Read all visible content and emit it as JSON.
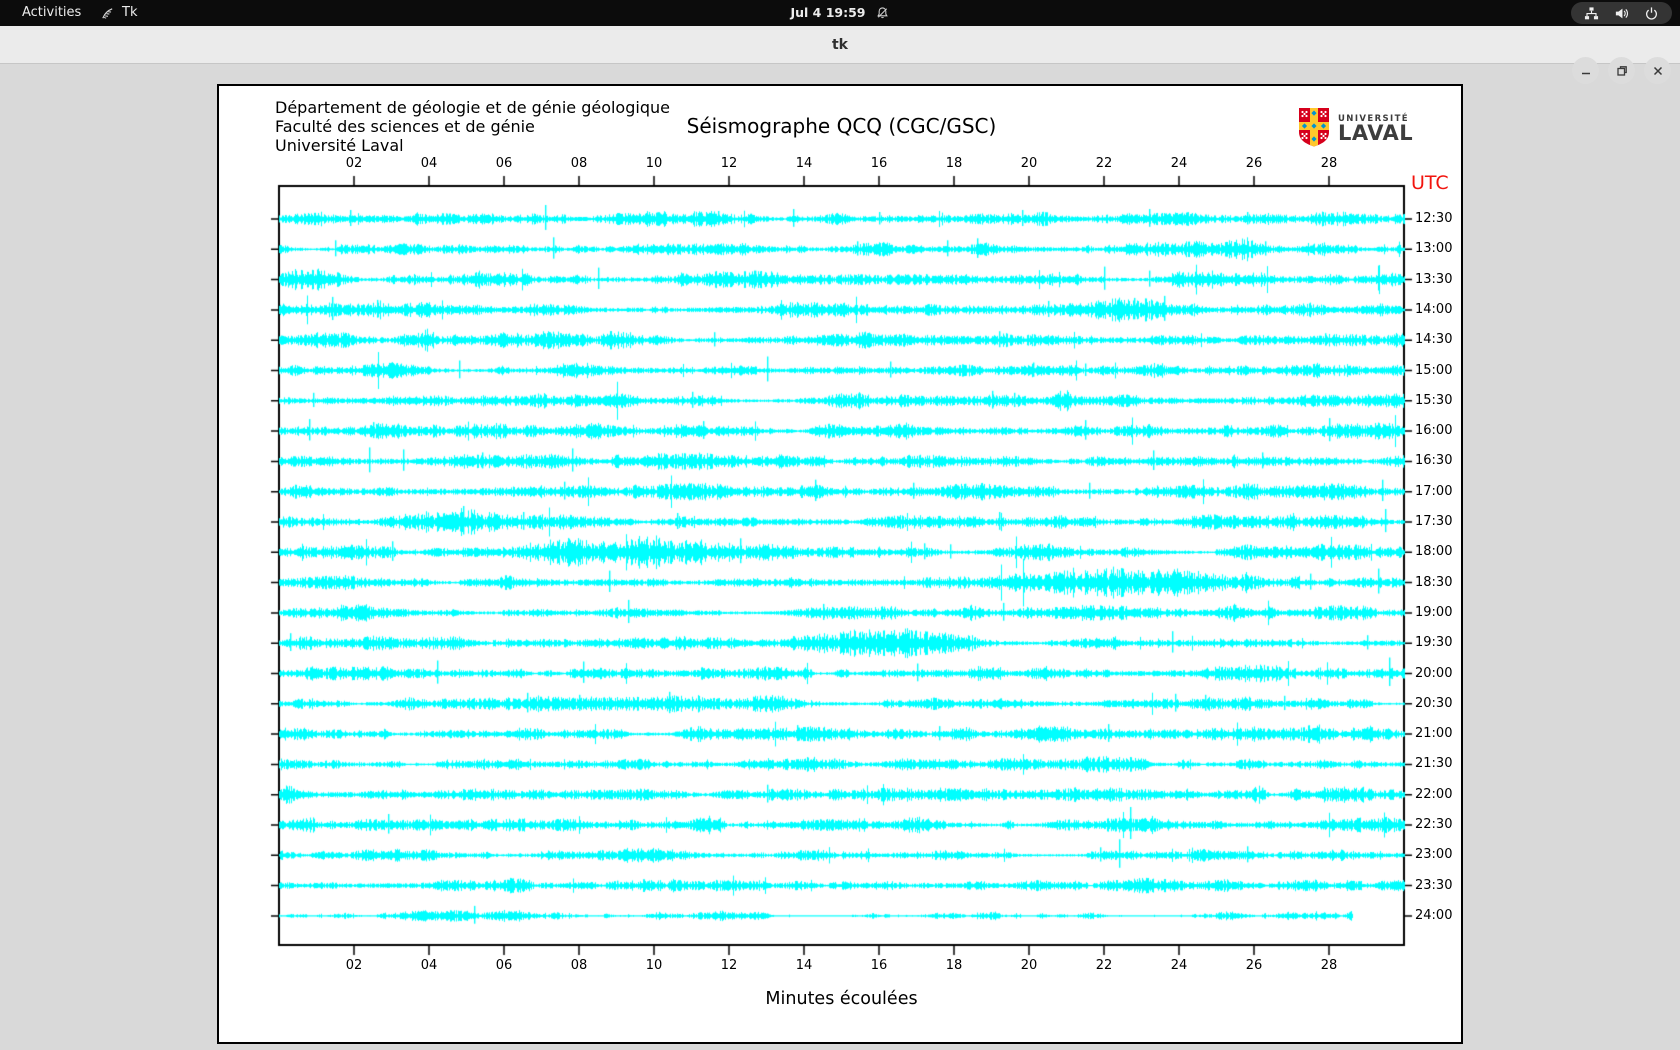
{
  "topbar": {
    "activities": "Activities",
    "app_menu": "Tk",
    "clock": "Jul 4 19:59"
  },
  "titlebar": {
    "title": "tk"
  },
  "panel": {
    "org_lines": [
      "Département de géologie et de génie géologique",
      "Faculté des sciences et de génie",
      "Université Laval"
    ],
    "title": "Séismographe QCQ (CGC/GSC)",
    "logo": {
      "top": "UNIVERSITÉ",
      "bottom": "LAVAL"
    },
    "utc": "UTC",
    "xlabel": "Minutes écoulées"
  },
  "chart_data": {
    "type": "line",
    "subtype": "helicorder",
    "title": "Séismographe QCQ (CGC/GSC)",
    "xlabel": "Minutes écoulées",
    "right_axis_label": "UTC",
    "x_range_minutes": [
      0,
      30
    ],
    "x_ticks": [
      "02",
      "04",
      "06",
      "08",
      "10",
      "12",
      "14",
      "16",
      "18",
      "20",
      "22",
      "24",
      "26",
      "28"
    ],
    "trace_color": "#00ffff",
    "axis_color": "#000000",
    "utc_color": "#f2140e",
    "rows": [
      {
        "label": "12:30",
        "base": 3.0,
        "end": 30,
        "bursts": [
          [
            0.2,
            1.6,
            2.0
          ]
        ],
        "spikes": [
          [
            1.9,
            9
          ],
          [
            7.1,
            14
          ],
          [
            11.7,
            8
          ],
          [
            13.7,
            10
          ],
          [
            16.0,
            7
          ],
          [
            19.8,
            9
          ],
          [
            23.2,
            10
          ],
          [
            25.8,
            7
          ]
        ]
      },
      {
        "label": "13:00",
        "base": 3.0,
        "end": 30,
        "bursts": [
          [
            25.0,
            26.5,
            2.5
          ]
        ],
        "spikes": [
          [
            1.5,
            9
          ],
          [
            7.3,
            12
          ],
          [
            15.4,
            8
          ],
          [
            17.8,
            9
          ],
          [
            18.6,
            11
          ],
          [
            26.3,
            8
          ]
        ]
      },
      {
        "label": "13:30",
        "base": 3.2,
        "end": 30,
        "bursts": [
          [
            0.0,
            1.8,
            2.5
          ]
        ],
        "spikes": [
          [
            8.5,
            12
          ],
          [
            12.7,
            9
          ],
          [
            22.0,
            13
          ],
          [
            23.2,
            9
          ],
          [
            29.3,
            14
          ]
        ]
      },
      {
        "label": "14:00",
        "base": 3.0,
        "end": 30,
        "bursts": [
          [
            2.2,
            3.2,
            3.5
          ],
          [
            21.5,
            24.3,
            3.5
          ]
        ],
        "spikes": [
          [
            1.4,
            13
          ],
          [
            2.6,
            10
          ],
          [
            20.5,
            9
          ],
          [
            22.8,
            12
          ],
          [
            23.6,
            14
          ]
        ]
      },
      {
        "label": "14:30",
        "base": 2.9,
        "end": 30,
        "bursts": [
          [
            3.6,
            4.4,
            3.0
          ],
          [
            8.4,
            9.8,
            3.5
          ]
        ],
        "spikes": [
          [
            11.6,
            8
          ],
          [
            19.2,
            9
          ],
          [
            27.9,
            7
          ]
        ]
      },
      {
        "label": "15:00",
        "base": 2.9,
        "end": 30,
        "bursts": [],
        "spikes": [
          [
            4.8,
            10
          ],
          [
            13.0,
            14
          ],
          [
            16.3,
            9
          ],
          [
            20.1,
            8
          ],
          [
            21.5,
            7
          ]
        ]
      },
      {
        "label": "15:30",
        "base": 3.0,
        "end": 30,
        "bursts": [
          [
            20.5,
            21.4,
            3.5
          ]
        ],
        "spikes": [
          [
            0.9,
            8
          ],
          [
            11.0,
            9
          ],
          [
            19.0,
            10
          ],
          [
            19.6,
            8
          ]
        ]
      },
      {
        "label": "16:00",
        "base": 3.1,
        "end": 30,
        "bursts": [],
        "spikes": [
          [
            0.8,
            12
          ],
          [
            2.5,
            9
          ],
          [
            11.3,
            10
          ],
          [
            21.5,
            11
          ],
          [
            28.0,
            13
          ]
        ]
      },
      {
        "label": "16:30",
        "base": 3.0,
        "end": 30,
        "bursts": [],
        "spikes": [
          [
            2.4,
            14
          ],
          [
            3.3,
            12
          ],
          [
            5.4,
            9
          ],
          [
            7.8,
            13
          ],
          [
            23.3,
            11
          ],
          [
            26.2,
            9
          ]
        ]
      },
      {
        "label": "17:00",
        "base": 3.0,
        "end": 30,
        "bursts": [],
        "spikes": [
          [
            7.6,
            10
          ],
          [
            14.3,
            12
          ],
          [
            16.9,
            9
          ],
          [
            18.3,
            8
          ],
          [
            21.6,
            9
          ],
          [
            25.7,
            8
          ],
          [
            29.4,
            12
          ]
        ]
      },
      {
        "label": "17:30",
        "base": 3.0,
        "end": 30,
        "bursts": [
          [
            2.3,
            7.8,
            5.5
          ]
        ],
        "spikes": [
          [
            4.9,
            16
          ],
          [
            6.5,
            10
          ],
          [
            10.6,
            9
          ],
          [
            19.2,
            10
          ],
          [
            29.5,
            13
          ]
        ]
      },
      {
        "label": "18:00",
        "base": 3.0,
        "end": 30,
        "bursts": [
          [
            6.3,
            14.2,
            6.5
          ]
        ],
        "spikes": [
          [
            3.0,
            11
          ],
          [
            12.3,
            14
          ],
          [
            17.2,
            9
          ],
          [
            17.9,
            8
          ]
        ]
      },
      {
        "label": "18:30",
        "base": 3.0,
        "end": 30,
        "bursts": [
          [
            18.2,
            29.8,
            5.5
          ]
        ],
        "spikes": [
          [
            8.8,
            12
          ],
          [
            24.0,
            10
          ],
          [
            27.5,
            9
          ],
          [
            29.3,
            14
          ]
        ]
      },
      {
        "label": "19:00",
        "base": 3.0,
        "end": 30,
        "bursts": [
          [
            24.8,
            26.2,
            2.5
          ]
        ],
        "spikes": [
          [
            9.3,
            13
          ],
          [
            14.5,
            9
          ],
          [
            19.3,
            10
          ],
          [
            25.5,
            8
          ]
        ]
      },
      {
        "label": "19:30",
        "base": 3.0,
        "end": 30,
        "bursts": [
          [
            13.5,
            20.5,
            5.5
          ]
        ],
        "spikes": [
          [
            0.3,
            10
          ],
          [
            23.8,
            12
          ],
          [
            29.0,
            8
          ]
        ]
      },
      {
        "label": "20:00",
        "base": 3.0,
        "end": 30,
        "bursts": [],
        "spikes": [
          [
            4.2,
            13
          ],
          [
            8.1,
            12
          ],
          [
            17.0,
            10
          ],
          [
            29.6,
            16
          ]
        ]
      },
      {
        "label": "20:30",
        "base": 2.9,
        "end": 30,
        "bursts": [],
        "spikes": [
          [
            6.6,
            11
          ],
          [
            8.0,
            9
          ],
          [
            10.4,
            12
          ],
          [
            13.4,
            8
          ],
          [
            23.9,
            10
          ],
          [
            24.7,
            9
          ],
          [
            26.8,
            8
          ]
        ]
      },
      {
        "label": "21:00",
        "base": 2.9,
        "end": 30,
        "bursts": [
          [
            27.2,
            28.0,
            2.5
          ]
        ],
        "spikes": [
          [
            13.8,
            9
          ],
          [
            17.6,
            8
          ],
          [
            22.1,
            10
          ],
          [
            29.0,
            7
          ]
        ]
      },
      {
        "label": "21:30",
        "base": 2.7,
        "end": 30,
        "bursts": [],
        "spikes": [
          [
            14.8,
            6
          ],
          [
            20.3,
            5
          ]
        ]
      },
      {
        "label": "22:00",
        "base": 2.8,
        "end": 30,
        "bursts": [
          [
            0.0,
            0.6,
            2.5
          ],
          [
            25.8,
            26.6,
            2.5
          ]
        ],
        "spikes": [
          [
            13.0,
            10
          ],
          [
            26.2,
            7
          ]
        ]
      },
      {
        "label": "22:30",
        "base": 3.0,
        "end": 30,
        "bursts": [
          [
            0.5,
            1.3,
            2.5
          ],
          [
            11.3,
            12.1,
            2.5
          ]
        ],
        "spikes": [
          [
            2.9,
            11
          ],
          [
            22.7,
            18
          ]
        ]
      },
      {
        "label": "23:00",
        "base": 2.7,
        "end": 30,
        "bursts": [],
        "spikes": [
          [
            21.9,
            8
          ],
          [
            22.4,
            16
          ],
          [
            25.8,
            9
          ]
        ]
      },
      {
        "label": "23:30",
        "base": 2.7,
        "end": 30,
        "bursts": [],
        "spikes": [
          [
            9.0,
            5
          ]
        ]
      },
      {
        "label": "24:00",
        "base": 1.5,
        "end": 28.6,
        "bursts": [],
        "spikes": [
          [
            5.2,
            10
          ]
        ]
      }
    ]
  }
}
